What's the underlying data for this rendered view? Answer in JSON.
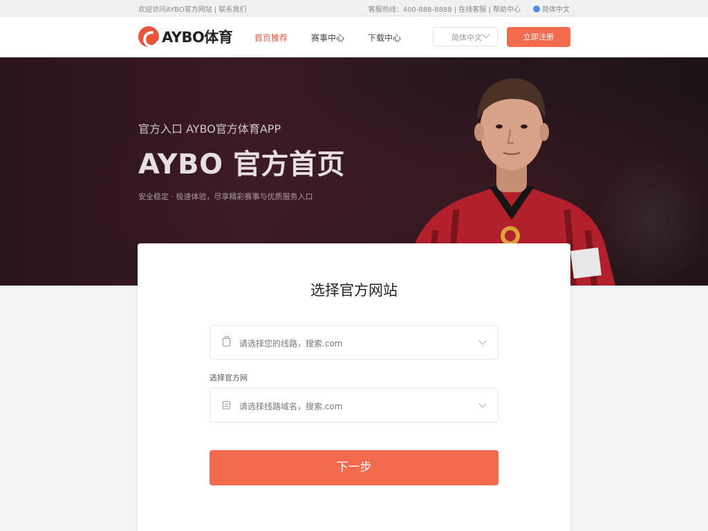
{
  "topbar": {
    "left_text": "欢迎访问AYBO官方网站 | 联系我们",
    "right_text": "客服热线：400-888-8888 | 在线客服 | 帮助中心",
    "lang": "简体中文"
  },
  "nav": {
    "logo_text": "AYBO体育",
    "links": [
      "首页推荐",
      "赛事中心",
      "下载中心"
    ],
    "lang_select": "简体中文",
    "cta": "立即注册"
  },
  "hero": {
    "subtitle": "官方入口  AYBO官方体育APP",
    "title": "AYBO 官方首页",
    "desc": "安全稳定 · 极速体验，尽享精彩赛事与优质服务入口"
  },
  "panel": {
    "title": "选择官方网站",
    "field1_text": "请选择您的线路，搜索.com",
    "field_label": "选择官方网",
    "field2_text": "请选择线路域名，搜索.com",
    "next_label": "下一步"
  },
  "colors": {
    "accent": "#f26b4f",
    "hero_bg": "#2a141c",
    "jersey": "#b2202c"
  }
}
